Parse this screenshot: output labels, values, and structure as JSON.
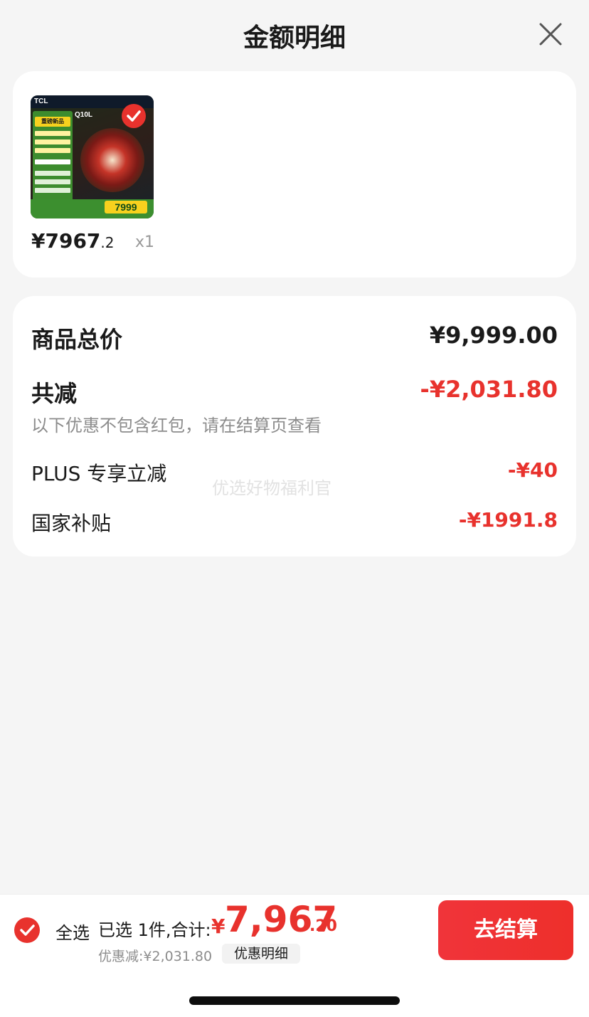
{
  "header": {
    "title": "金额明细",
    "close_icon": "close-icon"
  },
  "product": {
    "price_main": "¥7967",
    "price_decimal": ".2",
    "quantity": "x1",
    "thumb": {
      "brand": "TCL",
      "model": "Q10L",
      "tag": "重磅新品",
      "price_chip": "7999",
      "selected": true
    }
  },
  "summary": {
    "goods_total_label": "商品总价",
    "goods_total_value": "¥9,999.00",
    "reduction_label": "共减",
    "reduction_value": "-¥2,031.80",
    "reduction_note": "以下优惠不包含红包，请在结算页查看",
    "items": [
      {
        "label": "PLUS 专享立减",
        "value": "-¥40"
      },
      {
        "label": "国家补贴",
        "value": "-¥1991.8"
      }
    ],
    "watermark": "优选好物福利官"
  },
  "bottom_bar": {
    "select_all_label": "全选",
    "selected_text": "已选 1件,合计:",
    "total_currency": "¥",
    "total_integer": "7,967",
    "total_decimal": ".20",
    "discount_text": "优惠减:¥2,031.80",
    "detail_chip": "优惠明细",
    "checkout_label": "去结算"
  },
  "colors": {
    "accent": "#e8322d",
    "bg": "#f5f5f5"
  }
}
